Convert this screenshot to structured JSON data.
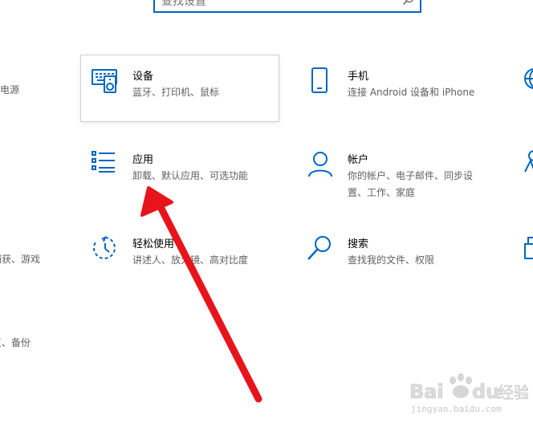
{
  "search": {
    "placeholder": "查找设置"
  },
  "left_column": [
    {
      "text": "电源"
    },
    {
      "text": "捕获、游戏"
    },
    {
      "text": "复、备份"
    }
  ],
  "tiles": [
    {
      "title": "设备",
      "desc": "蓝牙、打印机、鼠标",
      "icon": "devices-icon"
    },
    {
      "title": "手机",
      "desc": "连接 Android 设备和 iPhone",
      "icon": "phone-icon"
    },
    {
      "title": "应用",
      "desc": "卸载、默认应用、可选功能",
      "icon": "apps-icon"
    },
    {
      "title": "帐户",
      "desc": "你的帐户、电子邮件、同步设置、工作、家庭",
      "desc_line1": "你的帐户、电子邮件、同步设",
      "desc_line2": "置、工作、家庭",
      "icon": "account-icon"
    },
    {
      "title": "轻松使用",
      "desc": "讲述人、放大镜、高对比度",
      "icon": "ease-of-access-icon"
    },
    {
      "title": "搜索",
      "desc": "查找我的文件、权限",
      "icon": "search-icon"
    }
  ],
  "watermark": {
    "text": "Baidu 经验",
    "url": "jingyan.baidu.com"
  },
  "colors": {
    "accent": "#0067c0",
    "arrow": "#e8141c",
    "desc": "#5f5f5f"
  }
}
